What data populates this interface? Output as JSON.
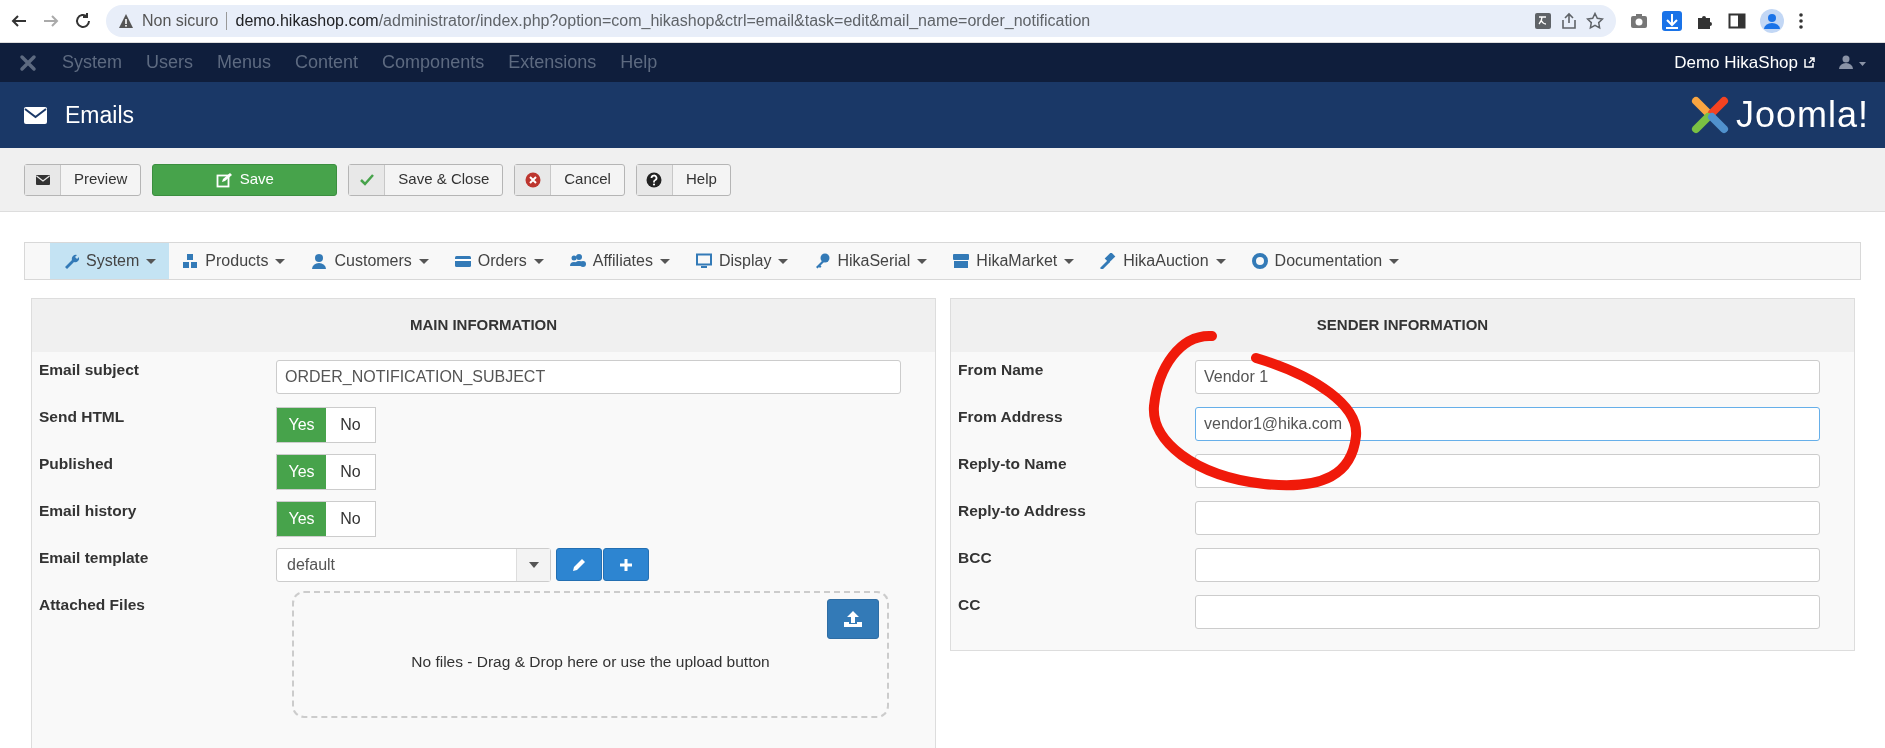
{
  "browser": {
    "security": "Non sicuro",
    "url_host": "demo.hikashop.com",
    "url_path": "/administrator/index.php?option=com_hikashop&ctrl=email&task=edit&mail_name=order_notification"
  },
  "top_menu": {
    "items": [
      "System",
      "Users",
      "Menus",
      "Content",
      "Components",
      "Extensions",
      "Help"
    ],
    "site_link": "Demo HikaShop"
  },
  "header": {
    "title": "Emails",
    "logo_text": "Joomla!"
  },
  "toolbar": [
    {
      "kind": "preview",
      "label": "Preview"
    },
    {
      "kind": "save",
      "label": "Save"
    },
    {
      "kind": "save-close",
      "label": "Save & Close"
    },
    {
      "kind": "cancel",
      "label": "Cancel"
    },
    {
      "kind": "help",
      "label": "Help"
    }
  ],
  "nav_menu": [
    {
      "kind": "system",
      "label": "System",
      "selected": true
    },
    {
      "kind": "products",
      "label": "Products",
      "selected": false
    },
    {
      "kind": "customers",
      "label": "Customers",
      "selected": false
    },
    {
      "kind": "orders",
      "label": "Orders",
      "selected": false
    },
    {
      "kind": "affiliates",
      "label": "Affiliates",
      "selected": false
    },
    {
      "kind": "display",
      "label": "Display",
      "selected": false
    },
    {
      "kind": "hikaserial",
      "label": "HikaSerial",
      "selected": false
    },
    {
      "kind": "hikamarket",
      "label": "HikaMarket",
      "selected": false
    },
    {
      "kind": "hikaauction",
      "label": "HikaAuction",
      "selected": false
    },
    {
      "kind": "documentation",
      "label": "Documentation",
      "selected": false
    }
  ],
  "main_information": {
    "title": "MAIN INFORMATION",
    "fields": [
      {
        "kind": "text",
        "label": "Email subject",
        "value": "ORDER_NOTIFICATION_SUBJECT"
      },
      {
        "kind": "toggle",
        "label": "Send HTML",
        "options": [
          {
            "label": "Yes",
            "selected": true
          },
          {
            "label": "No",
            "selected": false
          }
        ]
      },
      {
        "kind": "toggle",
        "label": "Published",
        "options": [
          {
            "label": "Yes",
            "selected": true
          },
          {
            "label": "No",
            "selected": false
          }
        ]
      },
      {
        "kind": "toggle",
        "label": "Email history",
        "options": [
          {
            "label": "Yes",
            "selected": true
          },
          {
            "label": "No",
            "selected": false
          }
        ]
      },
      {
        "kind": "select",
        "label": "Email template",
        "value": "default"
      },
      {
        "kind": "files",
        "label": "Attached Files",
        "message": "No files - Drag & Drop here or use the upload button"
      }
    ]
  },
  "sender_information": {
    "title": "SENDER INFORMATION",
    "fields": [
      {
        "label": "From Name",
        "value": "Vendor 1",
        "focused": false
      },
      {
        "label": "From Address",
        "value": "vendor1@hika.com",
        "focused": true
      },
      {
        "label": "Reply-to Name",
        "focused": false
      },
      {
        "label": "Reply-to Address",
        "focused": false
      },
      {
        "label": "BCC",
        "focused": false
      },
      {
        "label": "CC",
        "focused": false
      }
    ]
  }
}
